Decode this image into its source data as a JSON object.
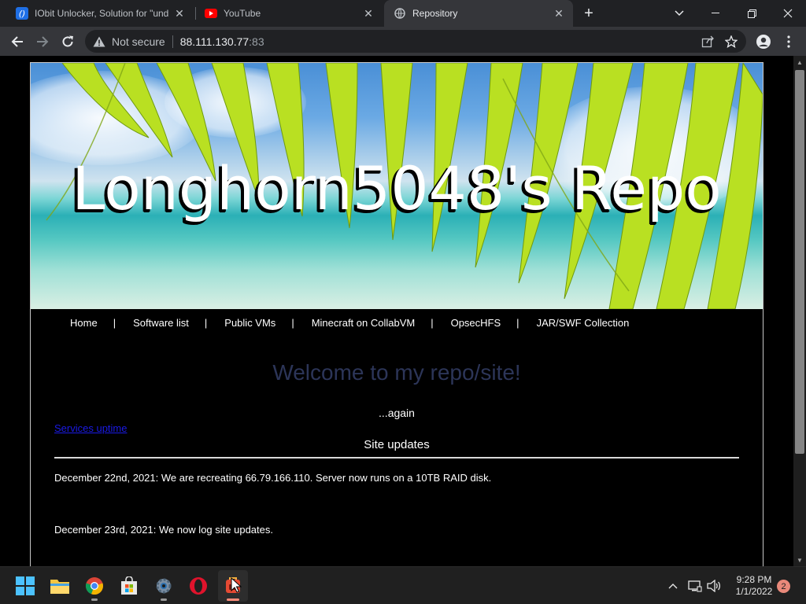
{
  "browser": {
    "tabs": [
      {
        "title": "IObit Unlocker, Solution for \"und",
        "icon": "iobit-icon",
        "active": false
      },
      {
        "title": "YouTube",
        "icon": "youtube-icon",
        "active": false
      },
      {
        "title": "Repository",
        "icon": "globe-icon",
        "active": true
      }
    ],
    "address": {
      "security_label": "Not secure",
      "host": "88.111.130.77",
      "port": ":83"
    }
  },
  "site": {
    "banner_title": "Longhorn5048's Repo",
    "nav": [
      {
        "label": "Home"
      },
      {
        "label": "Software list"
      },
      {
        "label": "Public VMs"
      },
      {
        "label": "Minecraft on CollabVM"
      },
      {
        "label": "OpsecHFS"
      },
      {
        "label": "JAR/SWF Collection"
      }
    ],
    "nav_separator": "|",
    "welcome": "Welcome to my repo/site!",
    "subtitle": "...again",
    "services_link": "Services uptime",
    "updates_heading": "Site updates",
    "updates": [
      "December 22nd, 2021: We are recreating 66.79.166.110. Server now runs on a 10TB RAID disk.",
      "December 23rd, 2021: We now log site updates."
    ]
  },
  "taskbar": {
    "apps": [
      {
        "name": "start-button",
        "running": false
      },
      {
        "name": "file-explorer",
        "running": false
      },
      {
        "name": "chrome",
        "running": true
      },
      {
        "name": "microsoft-store",
        "running": false
      },
      {
        "name": "settings",
        "running": true
      },
      {
        "name": "opera",
        "running": false
      },
      {
        "name": "iobit-unlocker",
        "running": true,
        "active": true
      }
    ],
    "time": "9:28 PM",
    "date": "1/1/2022",
    "notifications": "2"
  },
  "colors": {
    "welcome_text": "#2c3558",
    "link": "#1a1ae6",
    "notification_badge": "#e9897a"
  }
}
